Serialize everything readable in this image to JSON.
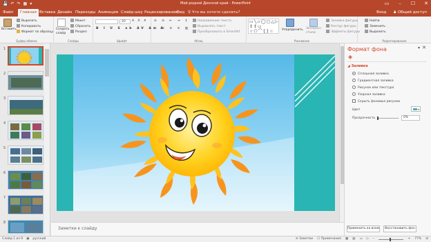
{
  "titlebar": {
    "title": "Мой родной Донской край - PowerPoint",
    "qat": [
      "💾",
      "↶",
      "↷",
      "▦",
      "▾"
    ],
    "win": [
      "▭",
      "–",
      "☐",
      "✕"
    ]
  },
  "tabs": {
    "items": [
      "Файл",
      "Главная",
      "Вставка",
      "Дизайн",
      "Переходы",
      "Анимация",
      "Слайд-шоу",
      "Рецензирование",
      "Вид"
    ],
    "active": "Главная",
    "tell_me": "♀ Что вы хотите сделать?",
    "sign_in": "Вход",
    "share": "♟ Общий доступ"
  },
  "ribbon": {
    "clipboard": {
      "label": "Буфер обмена",
      "paste": "Вставить",
      "cut": "Вырезать",
      "copy": "Копировать",
      "format_painter": "Формат по образцу"
    },
    "slides": {
      "label": "Слайды",
      "new_slide": "Создать слайд",
      "layout": "Макет",
      "reset": "Сбросить",
      "section": "Раздел"
    },
    "font": {
      "label": "Шрифт",
      "size": "20"
    },
    "paragraph": {
      "label": "Абзац",
      "direction": "Направление текста",
      "align": "Выровнять текст",
      "smartart": "Преобразовать в SmartArt"
    },
    "drawing": {
      "label": "Рисование",
      "arrange": "Упорядочить",
      "quick_styles": "Экспресс-стили",
      "fill": "Заливка фигуры",
      "outline": "Контур фигуры",
      "effects": "Эффекты фигуры",
      "shapes": "▭╲▱◯▢△▷ ↕↕▭ ☆⬠⌒{}☆"
    },
    "editing": {
      "label": "Редактирование",
      "find": "Найти",
      "replace": "Заменить",
      "select": "Выделить"
    }
  },
  "thumbnails": [
    {
      "num": "1",
      "bg": "#29b5b3",
      "selected": true
    },
    {
      "num": "2",
      "bg": "#5a7f8a",
      "selected": false,
      "caption": "Мой родной Донской край"
    },
    {
      "num": "3",
      "bg": "#3d6b7d",
      "selected": false
    },
    {
      "num": "4",
      "bg": "#4a7ea0",
      "selected": false
    },
    {
      "num": "5",
      "bg": "#5e9fc4",
      "selected": false
    },
    {
      "num": "6",
      "bg": "#4180b0",
      "selected": false
    },
    {
      "num": "7",
      "bg": "#3c6fa0",
      "selected": false
    },
    {
      "num": "8",
      "bg": "#3a8bb5",
      "selected": false
    }
  ],
  "notes": {
    "placeholder": "Заметки к слайду"
  },
  "format_pane": {
    "title": "Формат фона",
    "section": "◢ Заливка",
    "fill_options": [
      {
        "label": "Сплошная заливка",
        "checked": true
      },
      {
        "label": "Градиентная заливка",
        "checked": false
      },
      {
        "label": "Рисунок или текстура",
        "checked": false
      },
      {
        "label": "Узорная заливка",
        "checked": false
      }
    ],
    "hide_bg": "Скрыть фоновые рисунки",
    "color_label": "Цвет",
    "transparency_label": "Прозрачность",
    "transparency_value": "0%",
    "apply_all": "Применить ко всем",
    "reset_bg": "Восстановить фон"
  },
  "status": {
    "slide_info": "Слайд 1 из 9",
    "language": "русский",
    "notes_btn": "≡ Заметки",
    "comments_btn": "☐ Примечания",
    "zoom": "77%"
  },
  "colors": {
    "accent": "#b7472a",
    "pane_accent": "#d24726",
    "slide_teal": "#29b5b3",
    "sky": "#79c7ec",
    "sun": "#ffcc1c"
  }
}
